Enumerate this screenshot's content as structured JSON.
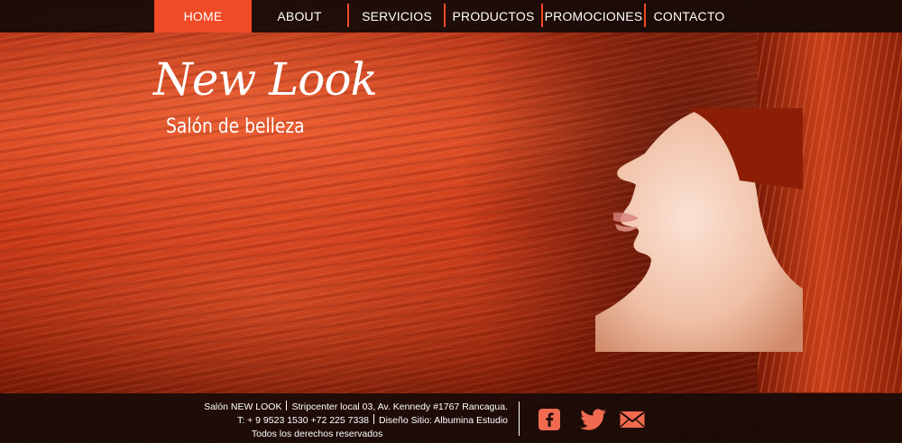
{
  "nav": {
    "items": [
      {
        "label": "HOME",
        "active": true
      },
      {
        "label": "ABOUT"
      },
      {
        "label": "SERVICIOS"
      },
      {
        "label": "PRODUCTOS"
      },
      {
        "label": "PROMOCIONES"
      },
      {
        "label": "CONTACTO"
      }
    ]
  },
  "logo": {
    "title": "New Look",
    "subtitle": "Salón de belleza"
  },
  "footer": {
    "line1_a": "Salón NEW LOOK",
    "line1_b": "Stripcenter local 03, Av. Kennedy #1767  Rancagua.",
    "line2_a": "T: + 9 9523 1530  +72 225 7338",
    "line2_b": "Diseño Sitio: Albumina Estudio",
    "line3": "Todos los derechos reservados"
  },
  "social": [
    "facebook-icon",
    "twitter-icon",
    "mail-icon"
  ],
  "colors": {
    "accent": "#ef4b26",
    "nav_bg": "#140a08",
    "icon": "#ef6a4f"
  }
}
